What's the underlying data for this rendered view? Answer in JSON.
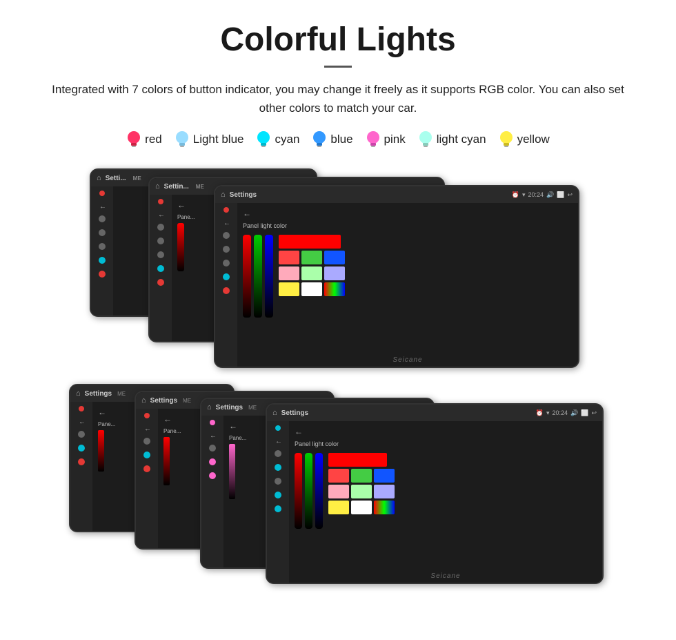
{
  "header": {
    "title": "Colorful Lights",
    "description": "Integrated with 7 colors of button indicator, you may change it freely as it supports RGB color. You can also set other colors to match your car."
  },
  "colors": [
    {
      "name": "red",
      "color": "#ff3366",
      "bulb": "red"
    },
    {
      "name": "Light blue",
      "color": "#66ccff",
      "bulb": "lightblue"
    },
    {
      "name": "cyan",
      "color": "#00e5ff",
      "bulb": "cyan"
    },
    {
      "name": "blue",
      "color": "#3399ff",
      "bulb": "blue"
    },
    {
      "name": "pink",
      "color": "#ff66cc",
      "bulb": "pink"
    },
    {
      "name": "light cyan",
      "color": "#aaffee",
      "bulb": "lightcyan"
    },
    {
      "name": "yellow",
      "color": "#ffee44",
      "bulb": "yellow"
    }
  ],
  "screen": {
    "settings_label": "Settings",
    "panel_label": "Panel light color",
    "watermark": "Seicane",
    "topbar_time": "20:24"
  }
}
